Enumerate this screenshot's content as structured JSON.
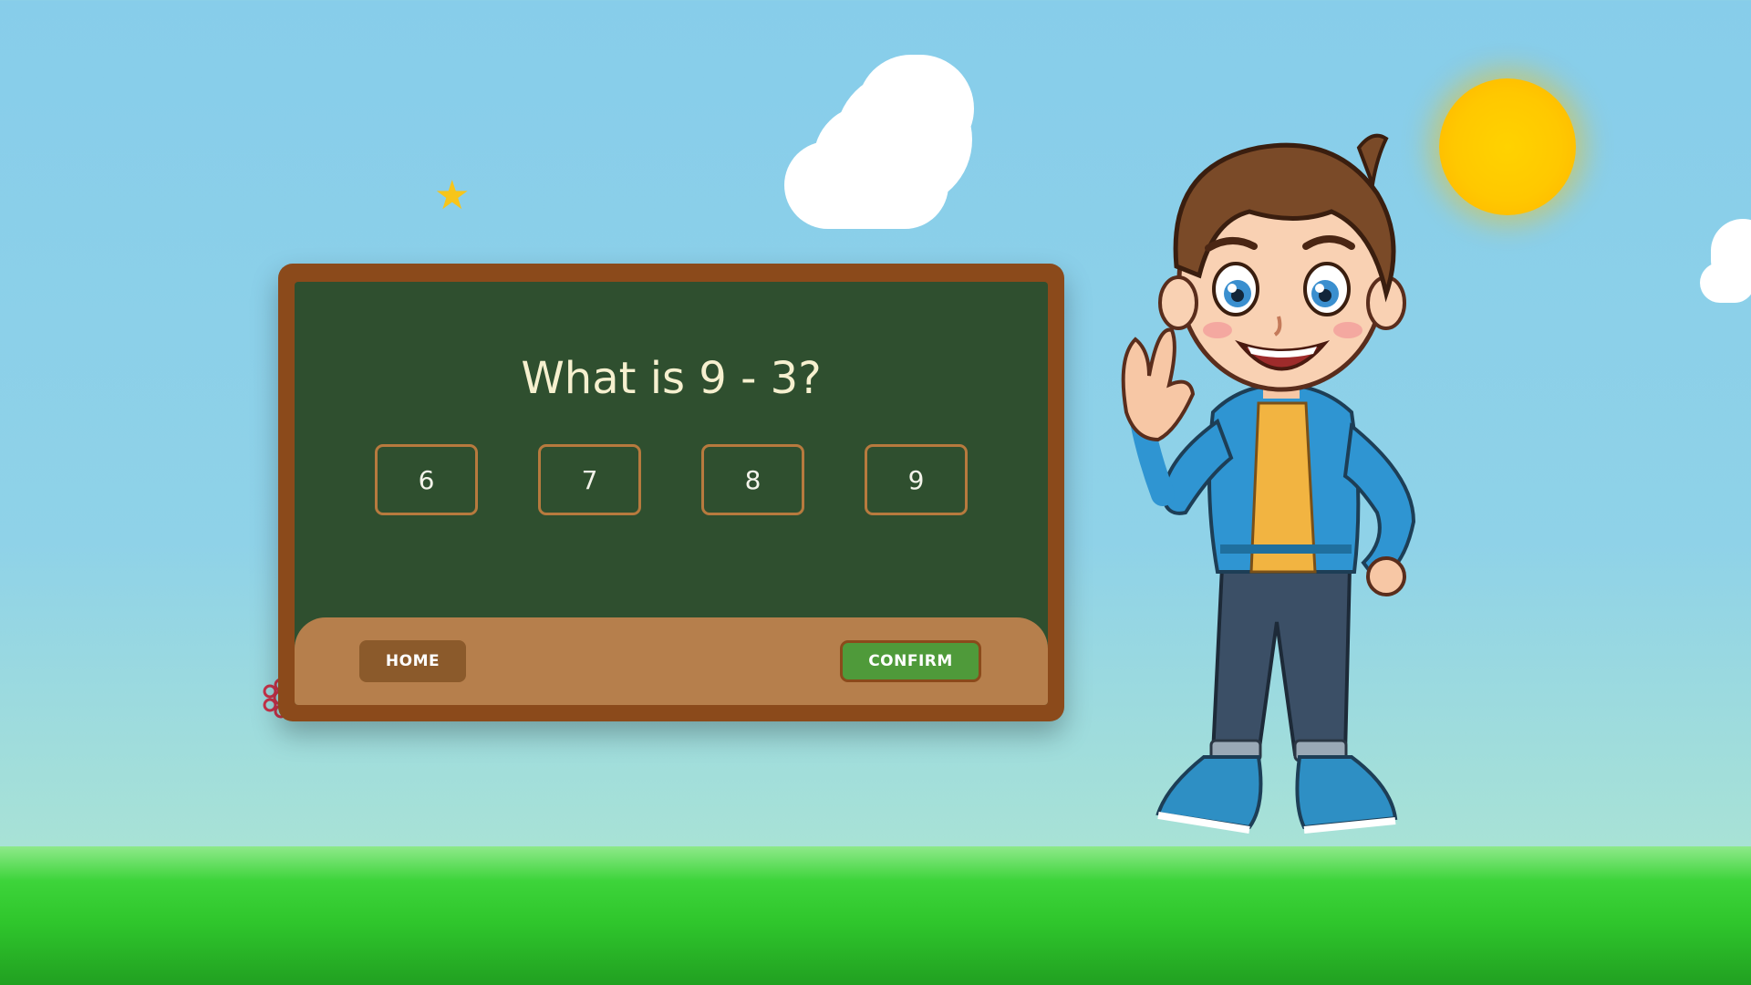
{
  "quiz": {
    "question": "What is 9 - 3?",
    "options": [
      "6",
      "7",
      "8",
      "9"
    ]
  },
  "buttons": {
    "home_label": "HOME",
    "confirm_label": "CONFIRM"
  },
  "colors": {
    "sky": "#87cdea",
    "ground": "#2fc62c",
    "board_frame": "#8b4a1b",
    "chalkboard": "#2f4f2f",
    "board_footer": "#b67f4c",
    "home_button": "#8b5a2b",
    "confirm_button": "#4f9a3a",
    "sun": "#ffc800"
  },
  "icons": [
    "star-icon",
    "flower-icon",
    "sun-icon",
    "cloud-icon"
  ]
}
